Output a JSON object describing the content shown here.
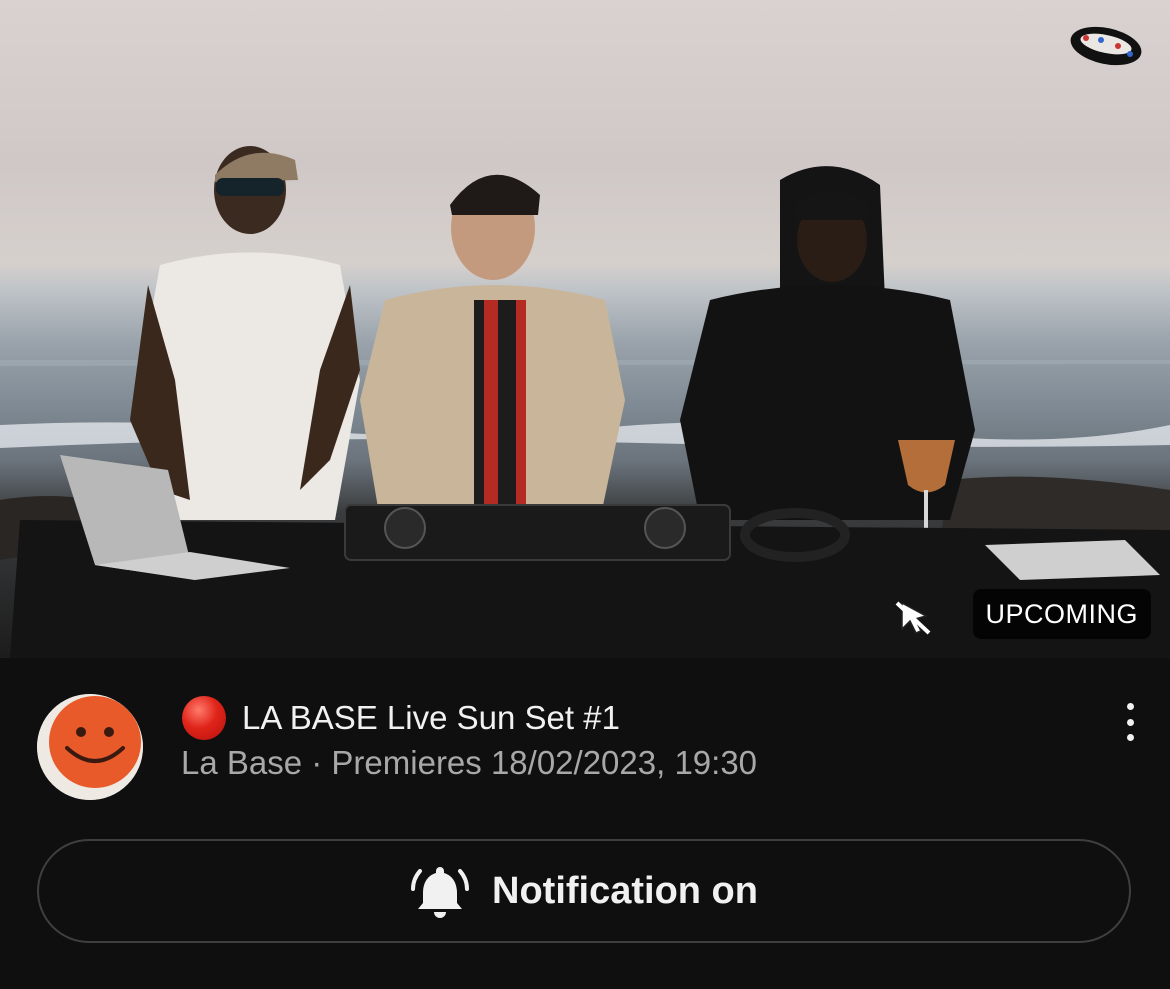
{
  "video": {
    "badge": "UPCOMING",
    "thumbnail_icon": "dj-beach-sunset-thumbnail",
    "watermark_icon": "channel-watermark-icon"
  },
  "meta": {
    "title_emoji": "red-circle",
    "title": "LA BASE Live Sun Set #1",
    "subtitle": "La Base · Premieres 18/02/2023, 19:30",
    "avatar_icon": "smiley-face-avatar",
    "menu_icon": "more-vertical-icon"
  },
  "notification_button": {
    "label": "Notification on",
    "icon": "bell-ringing-icon"
  },
  "colors": {
    "background": "#0f0f0f",
    "text": "#f1f1f1",
    "secondary_text": "#a8a8a8",
    "button_border": "#3f3f3f",
    "avatar_orange": "#e65a2c",
    "live_dot": "#e0241a"
  }
}
